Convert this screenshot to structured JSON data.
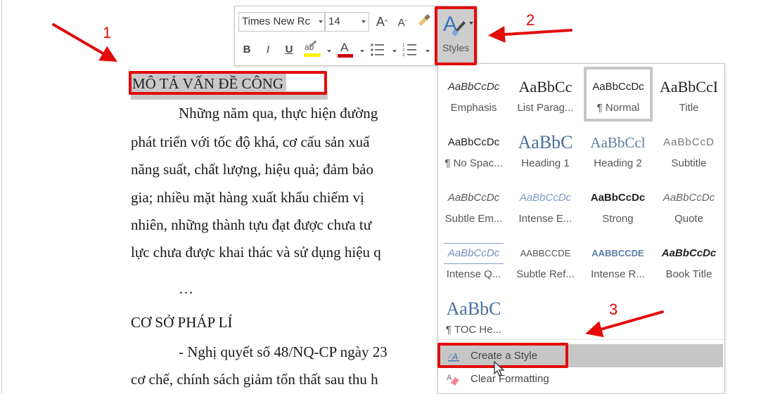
{
  "document": {
    "heading_selected": "MÔ TẢ VẤN ĐỀ CÔNG",
    "paragraph_lines": [
      "Những năm qua, thực hiện đường",
      "phát triển với tốc độ khá, cơ cấu sản xuấ",
      "năng suất, chất lượng, hiệu quả; đảm bảo",
      "gia; nhiều mặt hàng xuất khẩu chiếm vị",
      "nhiên, những thành tựu đạt được chưa tư",
      "lực chưa được khai thác và sử dụng hiệu q"
    ],
    "ellipsis": "…",
    "heading_2": "CƠ SỞ PHÁP LÍ",
    "legal_lines": [
      "- Nghị quyết số 48/NQ-CP ngày 23",
      "cơ chế, chính sách giảm tổn thất sau thu h"
    ]
  },
  "mini_toolbar": {
    "font_name": "Times New Rc",
    "font_size": "14",
    "grow_font": "A",
    "shrink_font": "A",
    "bold": "B",
    "italic": "I",
    "underline": "U",
    "highlight": "ab",
    "font_color": "A",
    "styles_label": "Styles",
    "highlight_color": "#f5f300",
    "font_color_value": "#d00000"
  },
  "styles_gallery": {
    "items": [
      {
        "preview": "AaBbCcDc",
        "name": "Emphasis",
        "selected": false
      },
      {
        "preview": "AaBbCc",
        "name": "List Parag...",
        "selected": false
      },
      {
        "preview": "AaBbCcDc",
        "name": "¶ Normal",
        "selected": true
      },
      {
        "preview": "AaBbCcI",
        "name": "Title",
        "selected": false
      },
      {
        "preview": "AaBbCcDc",
        "name": "¶ No Spac...",
        "selected": false
      },
      {
        "preview": "AaBbC",
        "name": "Heading 1",
        "selected": false
      },
      {
        "preview": "AaBbCcl",
        "name": "Heading 2",
        "selected": false
      },
      {
        "preview": "AaBbCcD",
        "name": "Subtitle",
        "selected": false
      },
      {
        "preview": "AaBbCcDc",
        "name": "Subtle Em...",
        "selected": false
      },
      {
        "preview": "AaBbCcDc",
        "name": "Intense E...",
        "selected": false
      },
      {
        "preview": "AaBbCcDc",
        "name": "Strong",
        "selected": false
      },
      {
        "preview": "AaBbCcDc",
        "name": "Quote",
        "selected": false
      },
      {
        "preview": "AaBbCcDc",
        "name": "Intense Q...",
        "selected": false
      },
      {
        "preview": "AABBCCDE",
        "name": "Subtle Ref...",
        "selected": false
      },
      {
        "preview": "AABBCCDE",
        "name": "Intense R...",
        "selected": false
      },
      {
        "preview": "AaBbCcDc",
        "name": "Book Title",
        "selected": false
      },
      {
        "preview": "AaBbC",
        "name": "¶ TOC He...",
        "selected": false
      }
    ],
    "menu": {
      "create_style": "Create a Style",
      "clear_formatting": "Clear Formatting"
    }
  },
  "annotations": {
    "step1": "1",
    "step2": "2",
    "step3": "3",
    "color": "#e30b0b"
  }
}
